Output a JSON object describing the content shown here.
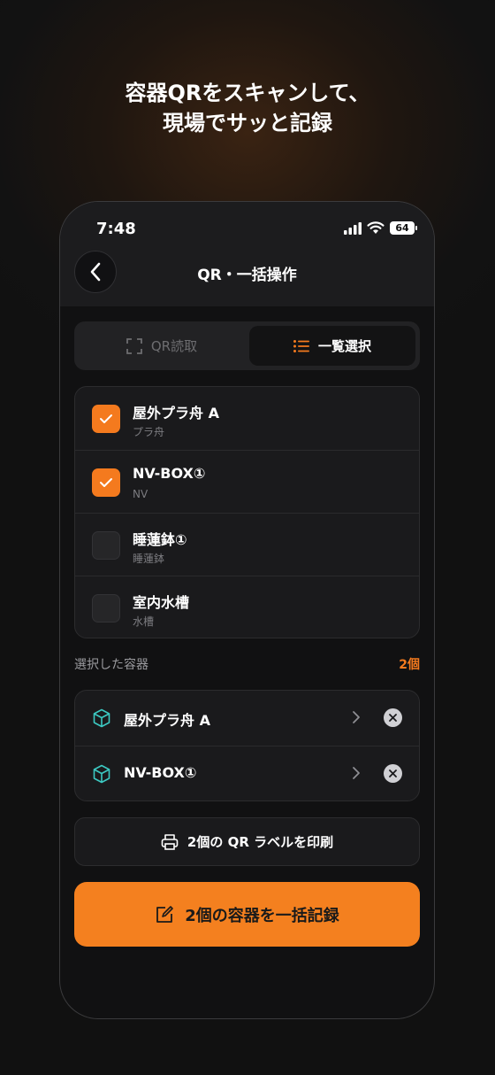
{
  "promo": {
    "headline_line1": "容器QRをスキャンして、",
    "headline_line2": "現場でサッと記録"
  },
  "status_bar": {
    "time": "7:48",
    "battery": "64",
    "icons": [
      "signal-icon",
      "wifi-icon",
      "battery-icon"
    ]
  },
  "nav": {
    "back_icon": "chevron-left-icon",
    "title": "QR・一括操作"
  },
  "segmented": {
    "tabs": [
      {
        "label": "QR読取",
        "icon": "scan-frame-icon",
        "active": false
      },
      {
        "label": "一覧選択",
        "icon": "list-icon",
        "active": true
      }
    ]
  },
  "containers": [
    {
      "name": "屋外プラ舟 A",
      "type": "プラ舟",
      "checked": true
    },
    {
      "name": "NV-BOX①",
      "type": "NV",
      "checked": true
    },
    {
      "name": "睡蓮鉢①",
      "type": "睡蓮鉢",
      "checked": false
    },
    {
      "name": "室内水槽",
      "type": "水槽",
      "checked": false
    }
  ],
  "selected": {
    "label": "選択した容器",
    "count": "2個",
    "items": [
      {
        "name": "屋外プラ舟 A",
        "icon": "cube-icon"
      },
      {
        "name": "NV-BOX①",
        "icon": "cube-icon"
      }
    ]
  },
  "actions": {
    "print_label": "2個の QR ラベルを印刷",
    "record_label": "2個の容器を一括記録"
  },
  "colors": {
    "accent": "#f47a1e",
    "cube_icon": "#3cc9c2",
    "background": "#111112"
  }
}
